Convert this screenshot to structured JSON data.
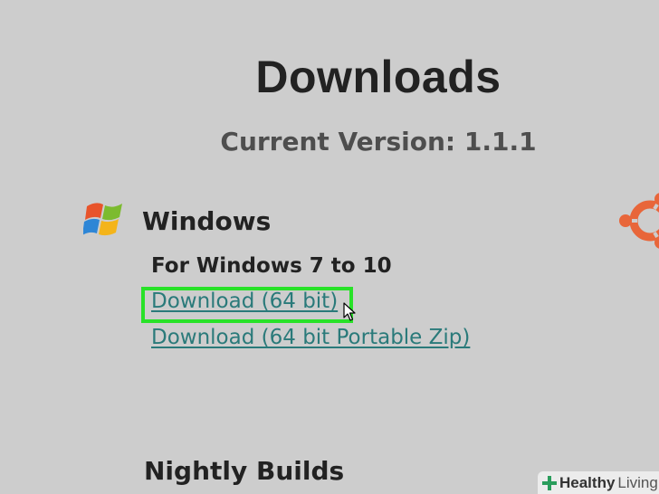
{
  "page": {
    "title": "Downloads",
    "current_version": "Current Version: 1.1.1"
  },
  "windows_section": {
    "heading": "Windows",
    "logo_icon": "windows-logo-icon",
    "subheading": "For Windows 7 to 10",
    "links": [
      {
        "label": "Download (64 bit)",
        "highlighted": true
      },
      {
        "label": "Download (64 bit Portable Zip)",
        "highlighted": false
      }
    ]
  },
  "ubuntu_logo_icon": "ubuntu-logo-icon",
  "nightly_section": {
    "heading": "Nightly Builds"
  },
  "watermark": {
    "brand_bold": "Healthy",
    "brand_regular": "Living"
  },
  "colors": {
    "background": "#cdcdcd",
    "link": "#2a7a7a",
    "highlight": "#28e228",
    "heading": "#222222"
  }
}
